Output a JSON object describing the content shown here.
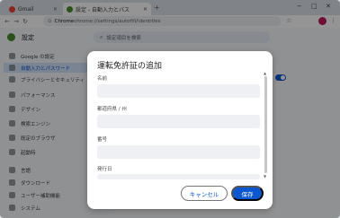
{
  "browser": {
    "tabs": [
      {
        "title": "Gmail",
        "favicon_color": "#ea4335",
        "active": false
      },
      {
        "title": "設定 - 自動入力とパス",
        "favicon_color": "#4c8a2c",
        "active": true
      }
    ],
    "new_tab": "+",
    "window_controls": [
      "−",
      "□",
      "✕"
    ],
    "nav": {
      "back": "←",
      "forward": "→",
      "reload": "↻"
    },
    "url_host": "Chrome",
    "url_path": "  chrome://settings/autofill/identities",
    "toolbar_icons": [
      "☆",
      "⋮"
    ]
  },
  "settings": {
    "title": "設定",
    "search_placeholder": "設定項目を検索",
    "sidebar": [
      {
        "label": "Google の設定",
        "active": false
      },
      {
        "label": "自動入力とパスワード",
        "active": true
      },
      {
        "label": "プライバシーとセキュリティ",
        "active": false
      },
      {
        "label": "パフォーマンス",
        "active": false
      },
      {
        "label": "デザイン",
        "active": false
      },
      {
        "label": "検索エンジン",
        "active": false
      },
      {
        "label": "既定のブラウザ",
        "active": false
      },
      {
        "label": "起動時",
        "active": false
      },
      {
        "label": "言語",
        "active": false
      },
      {
        "label": "ダウンロード",
        "active": false
      },
      {
        "label": "ユーザー補助機能",
        "active": false
      },
      {
        "label": "システム",
        "active": false
      }
    ]
  },
  "dialog": {
    "title": "運転免許証の追加",
    "fields": [
      {
        "label": "名前",
        "value": ""
      },
      {
        "label": "都道府県 / 州",
        "value": ""
      },
      {
        "label": "番号",
        "value": ""
      },
      {
        "label": "発行日",
        "value": ""
      }
    ],
    "cancel_label": "キャンセル",
    "save_label": "保存"
  },
  "colors": {
    "accent": "#0b57d0",
    "active_nav_bg": "#d3e3fd"
  }
}
